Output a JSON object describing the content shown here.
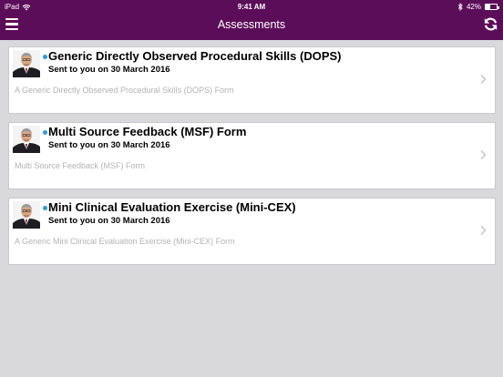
{
  "status_bar": {
    "device": "iPad",
    "time": "9:41 AM",
    "battery": "42%",
    "battery_level": 0.42
  },
  "nav": {
    "title": "Assessments",
    "menu_icon": "hamburger-menu-icon",
    "refresh_icon": "refresh-icon"
  },
  "colors": {
    "nav_background": "#5c0d59",
    "page_background": "#d9d9db",
    "unread_dot": "#2b9be0",
    "description_text": "#b3b3b3"
  },
  "assessments": [
    {
      "title": "Generic Directly Observed Procedural Skills (DOPS)",
      "sent": "Sent to you on 30 March 2016",
      "description": "A Generic Directly Observed Procedural Skills (DOPS) Form"
    },
    {
      "title": "Multi Source Feedback (MSF) Form",
      "sent": "Sent to you on 30 March 2016",
      "description": "Multi Source Feedback (MSF) Form"
    },
    {
      "title": "Mini Clinical Evaluation Exercise (Mini-CEX)",
      "sent": "Sent to you on 30 March 2016",
      "description": "A Generic Mini Clinical Evaluation Exercise (Mini-CEX) Form"
    }
  ]
}
